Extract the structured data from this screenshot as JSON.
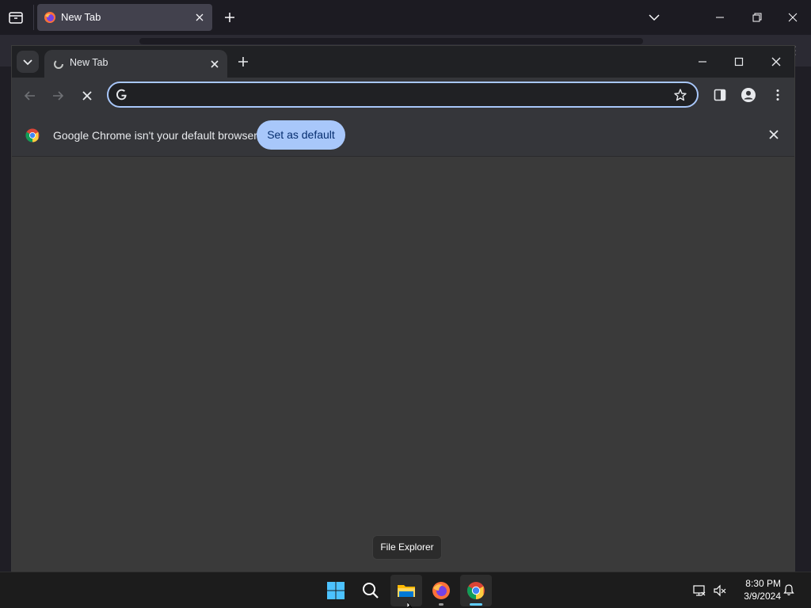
{
  "firefox": {
    "tab_title": "New Tab"
  },
  "chrome": {
    "tab_title": "New Tab",
    "omnibox": {
      "value": "",
      "placeholder": ""
    },
    "infobar": {
      "message": "Google Chrome isn't your default browser",
      "button_label": "Set as default"
    }
  },
  "tooltip": {
    "text": "File Explorer"
  },
  "taskbar": {
    "items": [
      "start-icon",
      "search-icon",
      "file-explorer-icon",
      "firefox-icon",
      "chrome-icon"
    ],
    "clock": {
      "time": "8:30 PM",
      "date": "3/9/2024"
    }
  },
  "colors": {
    "accent": "#a8c7fa",
    "chrome_frame": "#202124",
    "chrome_toolbar": "#35363a",
    "content_bg": "#3a3a3a",
    "taskbar_bg": "#1c1c1c"
  }
}
